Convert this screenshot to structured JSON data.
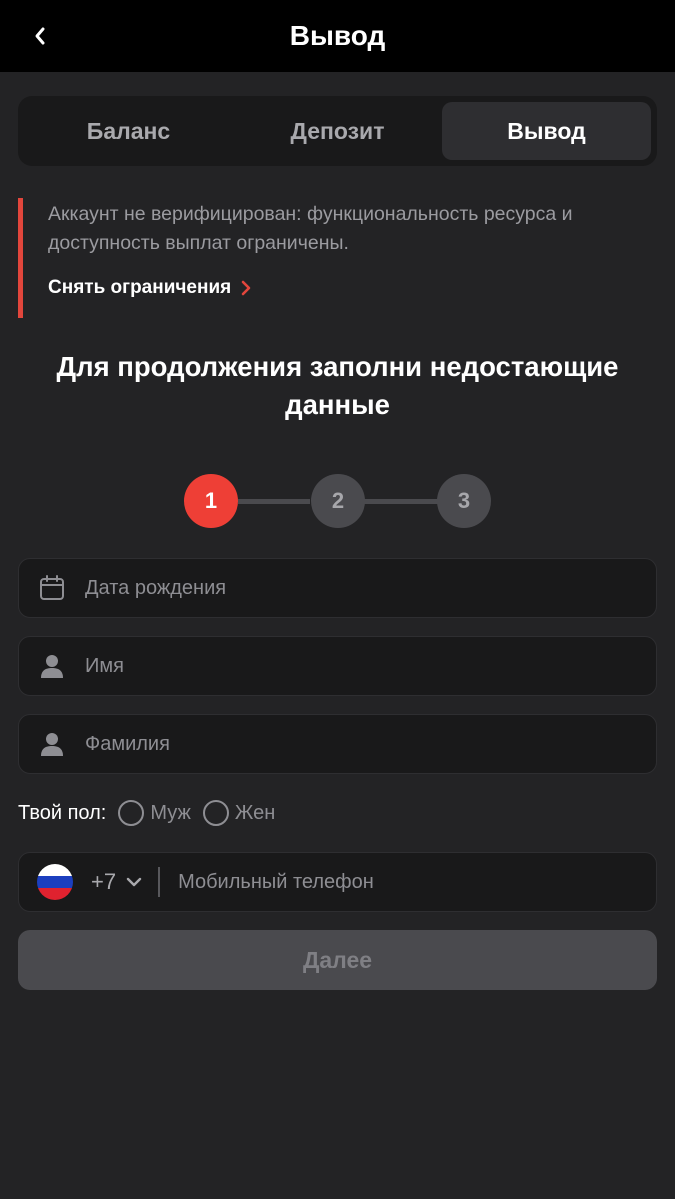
{
  "header": {
    "title": "Вывод",
    "back_icon": "chevron-left-icon"
  },
  "tabs": [
    {
      "label": "Баланс",
      "active": false
    },
    {
      "label": "Депозит",
      "active": false
    },
    {
      "label": "Вывод",
      "active": true
    }
  ],
  "alert": {
    "message": "Аккаунт не верифицирован: функциональность ресурса и доступность выплат ограничены.",
    "link_label": "Снять ограничения",
    "accent_color": "#e2463c"
  },
  "form": {
    "headline": "Для продолжения заполни недостающие данные",
    "steps": [
      {
        "number": "1",
        "active": true
      },
      {
        "number": "2",
        "active": false
      },
      {
        "number": "3",
        "active": false
      }
    ],
    "birthdate": {
      "placeholder": "Дата рождения",
      "value": "",
      "icon": "calendar-icon"
    },
    "first_name": {
      "placeholder": "Имя",
      "value": "",
      "icon": "user-icon"
    },
    "last_name": {
      "placeholder": "Фамилия",
      "value": "",
      "icon": "user-icon"
    },
    "gender": {
      "label": "Твой пол:",
      "options": [
        {
          "label": "Муж",
          "selected": false
        },
        {
          "label": "Жен",
          "selected": false
        }
      ]
    },
    "phone": {
      "country_code": "+7",
      "flag_icon": "russia-flag-icon",
      "placeholder": "Мобильный телефон",
      "value": ""
    },
    "next_label": "Далее"
  },
  "colors": {
    "background": "#232325",
    "accent": "#ee3f36",
    "disabled_button": "#4a4a4e"
  }
}
